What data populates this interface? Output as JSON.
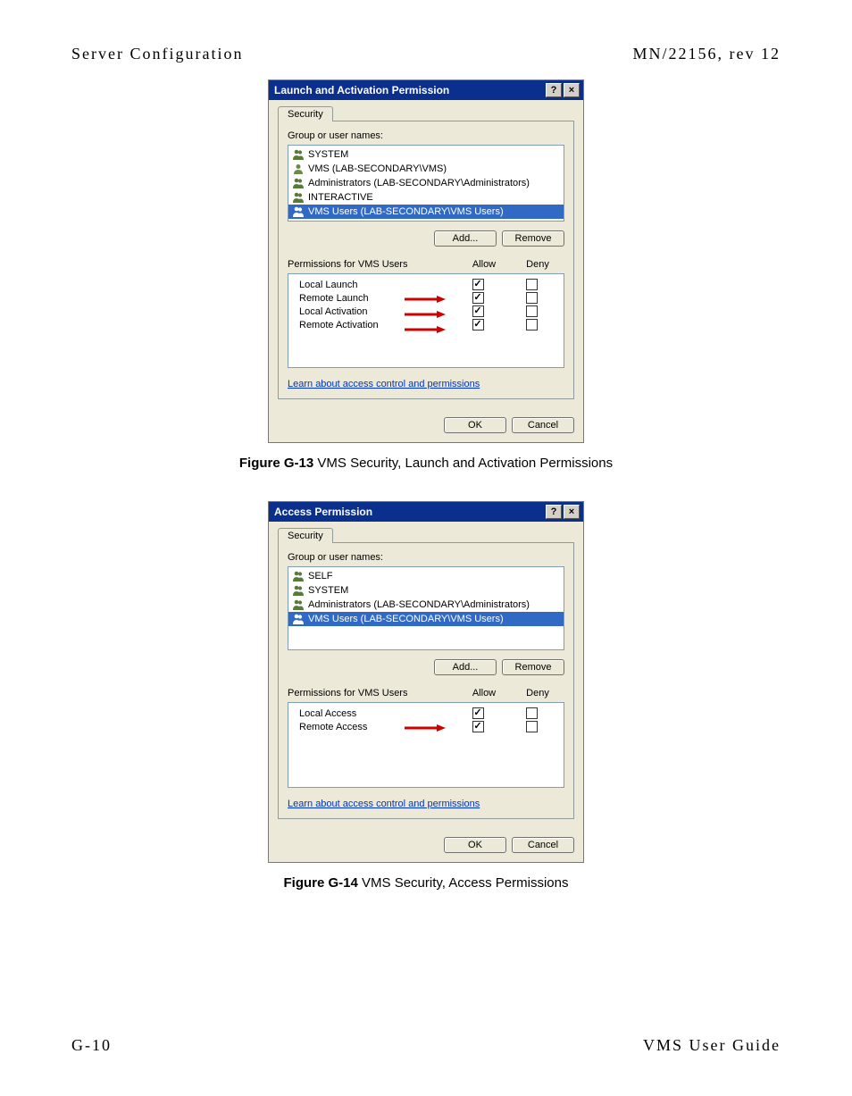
{
  "header": {
    "left": "Server Configuration",
    "right": "MN/22156, rev 12"
  },
  "footer": {
    "left": "G-10",
    "right": "VMS User Guide"
  },
  "dialog1": {
    "title": "Launch and Activation Permission",
    "tab": "Security",
    "group_label": "Group or user names:",
    "users": [
      {
        "name": "SYSTEM",
        "icon": "group"
      },
      {
        "name": "VMS (LAB-SECONDARY\\VMS)",
        "icon": "user"
      },
      {
        "name": "Administrators (LAB-SECONDARY\\Administrators)",
        "icon": "group"
      },
      {
        "name": "INTERACTIVE",
        "icon": "group"
      },
      {
        "name": "VMS Users (LAB-SECONDARY\\VMS Users)",
        "icon": "group",
        "selected": true
      }
    ],
    "add": "Add...",
    "remove": "Remove",
    "perm_label": "Permissions for VMS Users",
    "allow": "Allow",
    "deny": "Deny",
    "perms": [
      {
        "name": "Local Launch",
        "allow": true,
        "deny": false,
        "arrow": false
      },
      {
        "name": "Remote Launch",
        "allow": true,
        "deny": false,
        "arrow": true
      },
      {
        "name": "Local Activation",
        "allow": true,
        "deny": false,
        "arrow": true
      },
      {
        "name": "Remote Activation",
        "allow": true,
        "deny": false,
        "arrow": true
      }
    ],
    "link": "Learn about access control and permissions",
    "ok": "OK",
    "cancel": "Cancel"
  },
  "caption1": {
    "bold": "Figure G-13",
    "rest": "   VMS Security, Launch and Activation Permissions"
  },
  "dialog2": {
    "title": "Access Permission",
    "tab": "Security",
    "group_label": "Group or user names:",
    "users": [
      {
        "name": "SELF",
        "icon": "group"
      },
      {
        "name": "SYSTEM",
        "icon": "group"
      },
      {
        "name": "Administrators (LAB-SECONDARY\\Administrators)",
        "icon": "group"
      },
      {
        "name": "VMS Users (LAB-SECONDARY\\VMS Users)",
        "icon": "group",
        "selected": true
      }
    ],
    "add": "Add...",
    "remove": "Remove",
    "perm_label": "Permissions for VMS Users",
    "allow": "Allow",
    "deny": "Deny",
    "perms": [
      {
        "name": "Local Access",
        "allow": true,
        "deny": false,
        "arrow": false
      },
      {
        "name": "Remote Access",
        "allow": true,
        "deny": false,
        "arrow": true
      }
    ],
    "link": "Learn about access control and permissions",
    "ok": "OK",
    "cancel": "Cancel"
  },
  "caption2": {
    "bold": "Figure G-14",
    "rest": "   VMS Security, Access Permissions"
  }
}
